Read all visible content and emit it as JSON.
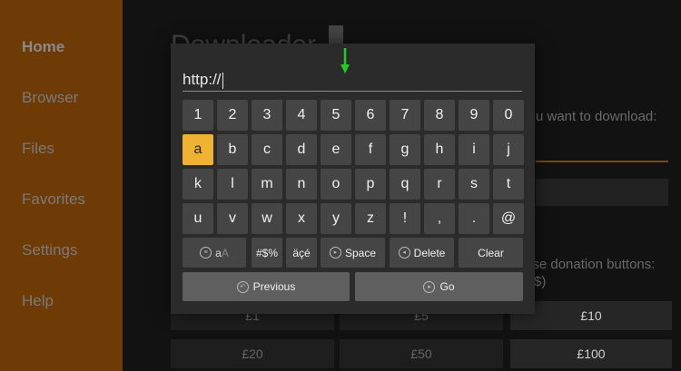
{
  "sidebar": {
    "items": [
      {
        "label": "Home"
      },
      {
        "label": "Browser"
      },
      {
        "label": "Files"
      },
      {
        "label": "Favorites"
      },
      {
        "label": "Settings"
      },
      {
        "label": "Help"
      }
    ]
  },
  "background": {
    "app_title": "Downloader",
    "prompt_text": "u want to download:",
    "donation_prompt": "ase donation buttons:",
    "donation_prompt_line2": "$)",
    "donation_row1": [
      "£1",
      "£5",
      "£10"
    ],
    "donation_row2": [
      "£20",
      "£50",
      "£100"
    ]
  },
  "keyboard": {
    "input_value": "http://",
    "focus_arrow_color": "#22cc22",
    "accent_color": "#f0b232",
    "rows": [
      [
        "1",
        "2",
        "3",
        "4",
        "5",
        "6",
        "7",
        "8",
        "9",
        "0"
      ],
      [
        "a",
        "b",
        "c",
        "d",
        "e",
        "f",
        "g",
        "h",
        "i",
        "j"
      ],
      [
        "k",
        "l",
        "m",
        "n",
        "o",
        "p",
        "q",
        "r",
        "s",
        "t"
      ],
      [
        "u",
        "v",
        "w",
        "x",
        "y",
        "z",
        "!",
        ",",
        ".",
        "@"
      ]
    ],
    "focused_key": "a",
    "function_keys": {
      "case_label_lower": "a",
      "case_label_upper": "A",
      "symbols_label": "#$%",
      "accents_label": "äçé",
      "space_label": "Space",
      "delete_label": "Delete",
      "clear_label": "Clear"
    },
    "previous_label": "Previous",
    "go_label": "Go"
  }
}
